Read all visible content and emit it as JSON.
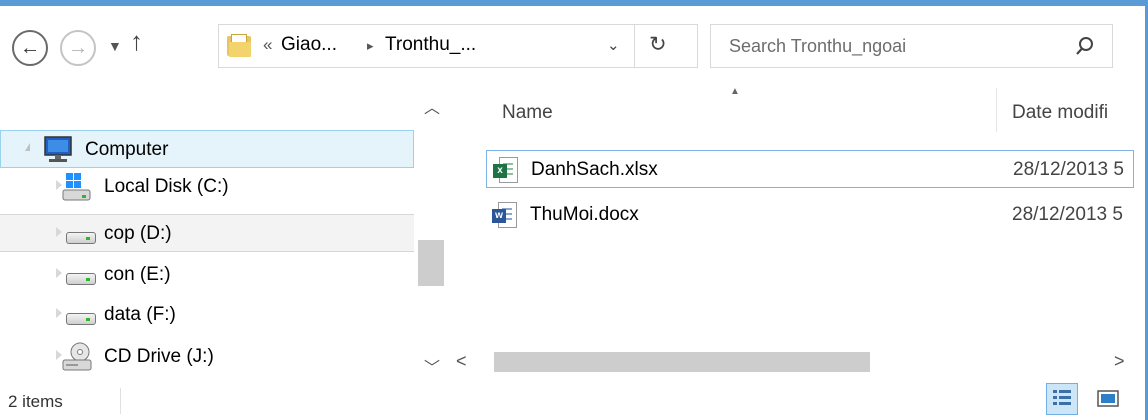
{
  "address": {
    "overflow": "«",
    "segments": [
      "Giao...",
      "Tronthu_..."
    ],
    "separator": "▸"
  },
  "search": {
    "placeholder": "Search Tronthu_ngoai"
  },
  "nav": {
    "items": [
      {
        "label": "Computer",
        "icon": "computer-icon",
        "state": "selected",
        "expanded": true
      },
      {
        "label": "Local Disk (C:)",
        "icon": "windows-drive-icon",
        "expanded": false
      },
      {
        "label": "cop (D:)",
        "icon": "drive-icon",
        "state": "hover",
        "expanded": false
      },
      {
        "label": "con (E:)",
        "icon": "drive-icon",
        "expanded": false
      },
      {
        "label": "data (F:)",
        "icon": "drive-icon",
        "expanded": false
      },
      {
        "label": "CD Drive (J:)",
        "icon": "cd-drive-icon",
        "expanded": false
      }
    ]
  },
  "files": {
    "columns": {
      "name": "Name",
      "date": "Date modifi"
    },
    "rows": [
      {
        "name": "DanhSach.xlsx",
        "date": "28/12/2013 5",
        "type": "excel-icon",
        "badge": "x",
        "color": "#1f7244"
      },
      {
        "name": "ThuMoi.docx",
        "date": "28/12/2013 5",
        "type": "word-icon",
        "badge": "w",
        "color": "#2b579a"
      }
    ]
  },
  "status": {
    "count": "2 items"
  },
  "colors": {
    "accent": "#5b9bd5",
    "selection_bg": "#e5f3fb",
    "selection_border": "#99d1ef"
  }
}
